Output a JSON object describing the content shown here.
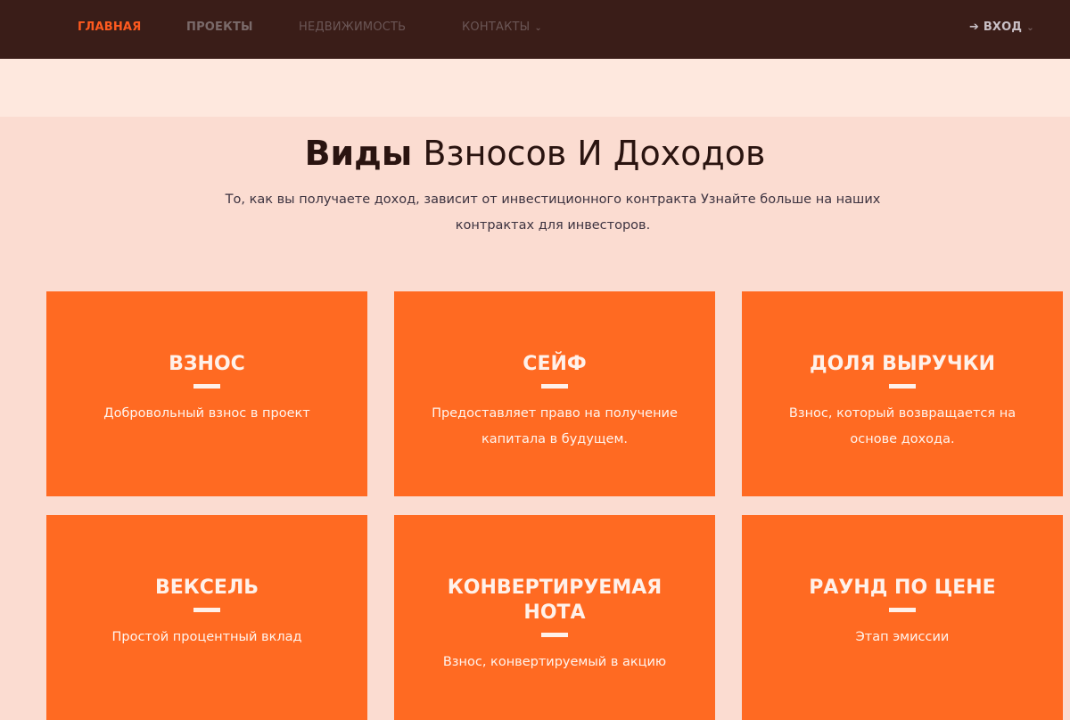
{
  "nav": {
    "items": [
      "ГЛАВНАЯ",
      "ПРОЕКТЫ",
      "НЕДВИЖИМОСТЬ",
      "КОНТАКТЫ"
    ],
    "login": "ВХОД",
    "accent": "#ff5a1f",
    "background": "#3a1d18"
  },
  "hero": {
    "title_bold": "Виды",
    "title_rest": " Взносов И Доходов",
    "subtitle": "То, как вы получаете доход, зависит от инвестиционного контракта Узнайте больше на наших контрактах для инвесторов."
  },
  "cards": [
    {
      "title": "ВЗНОС",
      "text": "Добровольный взнос в проект"
    },
    {
      "title": "СЕЙФ",
      "text": "Предоставляет право на получение капитала в будущем."
    },
    {
      "title": "ДОЛЯ ВЫРУЧКИ",
      "text": "Взнос, который возвращается на основе дохода."
    },
    {
      "title": "ВЕКСЕЛЬ",
      "text": "Простой процентный вклад"
    },
    {
      "title": "КОНВЕРТИРУЕМАЯ НОТА",
      "text": "Взнос, конвертируемый в акцию"
    },
    {
      "title": "РАУНД ПО ЦЕНЕ",
      "text": "Этап эмиссии"
    }
  ],
  "card_color": "#ff6a22"
}
